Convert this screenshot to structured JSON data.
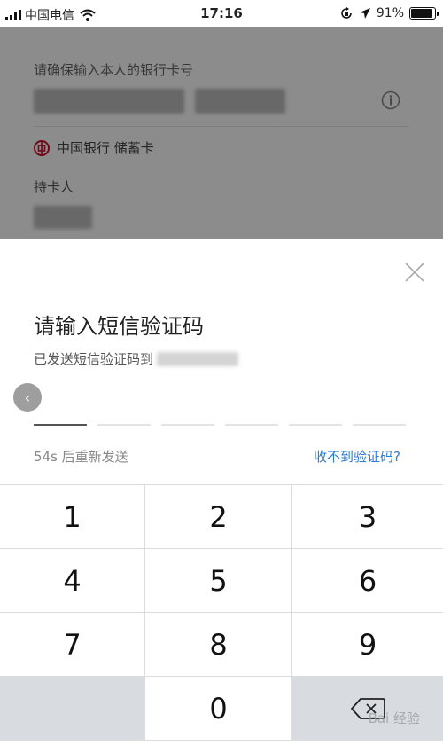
{
  "status_bar": {
    "carrier": "中国电信",
    "time": "17:16",
    "battery_text": "91%",
    "battery_level": 0.91
  },
  "background_form": {
    "card_hint": "请确保输入本人的银行卡号",
    "bank_name": "中国银行 储蓄卡",
    "holder_label": "持卡人"
  },
  "sheet": {
    "title": "请输入短信验证码",
    "sent_text": "已发送短信验证码到",
    "resend_text": "54s 后重新发送",
    "no_code_link": "收不到验证码?"
  },
  "keypad": {
    "keys": [
      "1",
      "2",
      "3",
      "4",
      "5",
      "6",
      "7",
      "8",
      "9",
      "0"
    ]
  },
  "watermark": "Bai 经验",
  "colors": {
    "link": "#2d7bd6",
    "bank_red": "#c8102e",
    "keypad_gray": "#d8dbe0"
  },
  "icons": [
    "signal-icon",
    "wifi-icon",
    "lock-rotation-icon",
    "location-arrow-icon",
    "battery-icon",
    "info-icon",
    "bank-of-china-logo",
    "close-icon",
    "back-arrow-icon",
    "backspace-icon"
  ]
}
